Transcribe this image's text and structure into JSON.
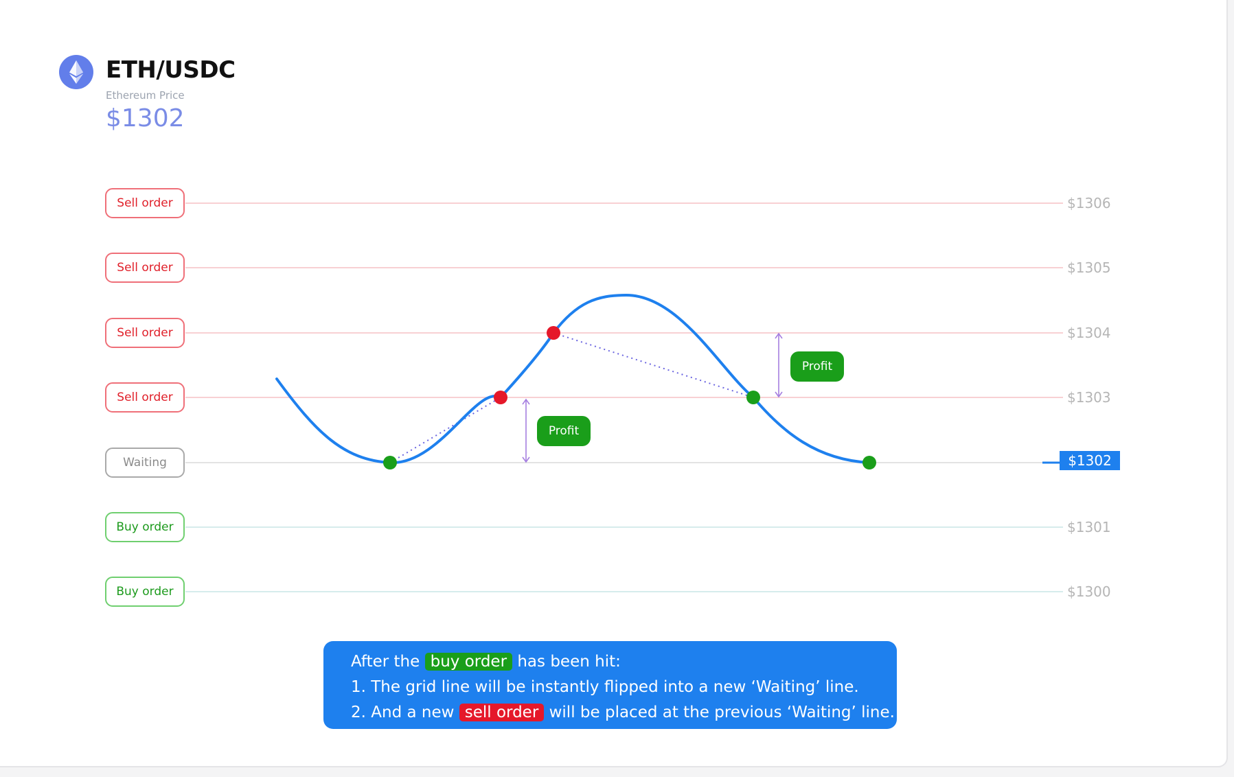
{
  "header": {
    "icon": "ethereum-icon",
    "pair": "ETH/USDC",
    "price_label": "Ethereum Price",
    "price": "$1302"
  },
  "grid": {
    "levels": [
      {
        "label": "Sell order",
        "type": "sell",
        "price": "$1306"
      },
      {
        "label": "Sell order",
        "type": "sell",
        "price": "$1305"
      },
      {
        "label": "Sell order",
        "type": "sell",
        "price": "$1304"
      },
      {
        "label": "Sell order",
        "type": "sell",
        "price": "$1303"
      },
      {
        "label": "Waiting",
        "type": "waiting",
        "price": "$1302"
      },
      {
        "label": "Buy order",
        "type": "buy",
        "price": "$1301"
      },
      {
        "label": "Buy order",
        "type": "buy",
        "price": "$1300"
      }
    ],
    "current_price_tag": "$1302"
  },
  "profit_labels": [
    "Profit",
    "Profit"
  ],
  "info": {
    "line1_prefix": "After the",
    "line1_highlight": "buy order",
    "line1_suffix": "has been hit:",
    "line2": "1. The grid line will be instantly flipped into a new ‘Waiting’ line.",
    "line3_prefix": "2. And a new",
    "line3_highlight": "sell order",
    "line3_suffix": "will be placed at the previous ‘Waiting’ line."
  },
  "colors": {
    "curve": "#1e80ee",
    "sell_line": "#f8d0d3",
    "buy_line": "#d6ecec",
    "waiting_line": "#e3e3e3",
    "buy_dot": "#1a9e1a",
    "sell_dot": "#e5182a",
    "arrow": "#a57ee0"
  }
}
